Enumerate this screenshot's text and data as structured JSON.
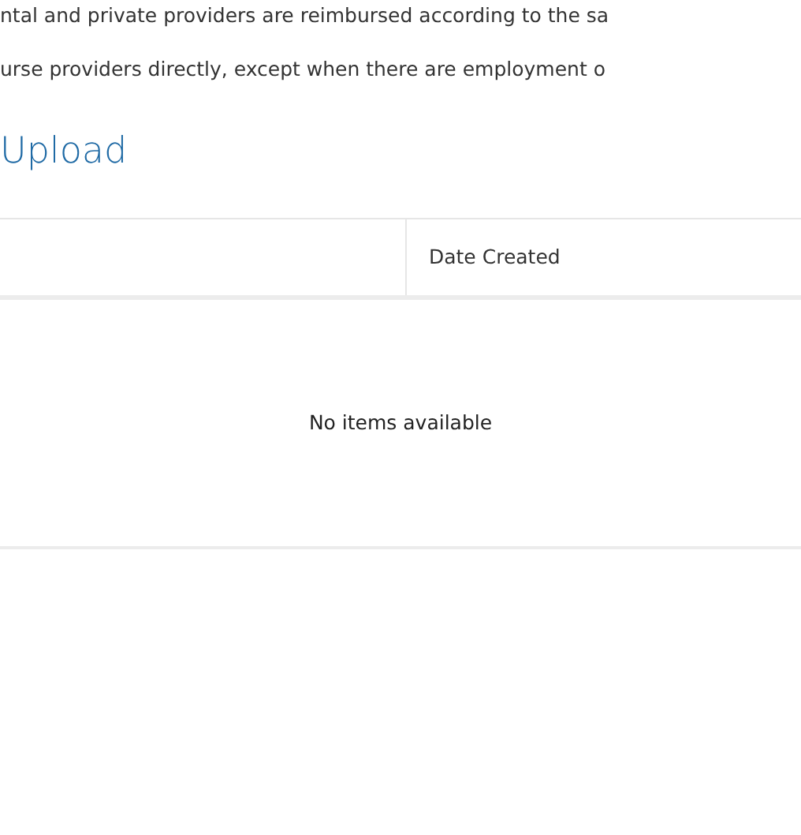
{
  "text_lines": [
    "ntal and private providers are reimbursed according to the sa",
    "urse providers directly, except when there are employment o"
  ],
  "section_title": "Upload",
  "table": {
    "columns": [
      "",
      "Date Created"
    ],
    "empty_message": "No items available"
  }
}
